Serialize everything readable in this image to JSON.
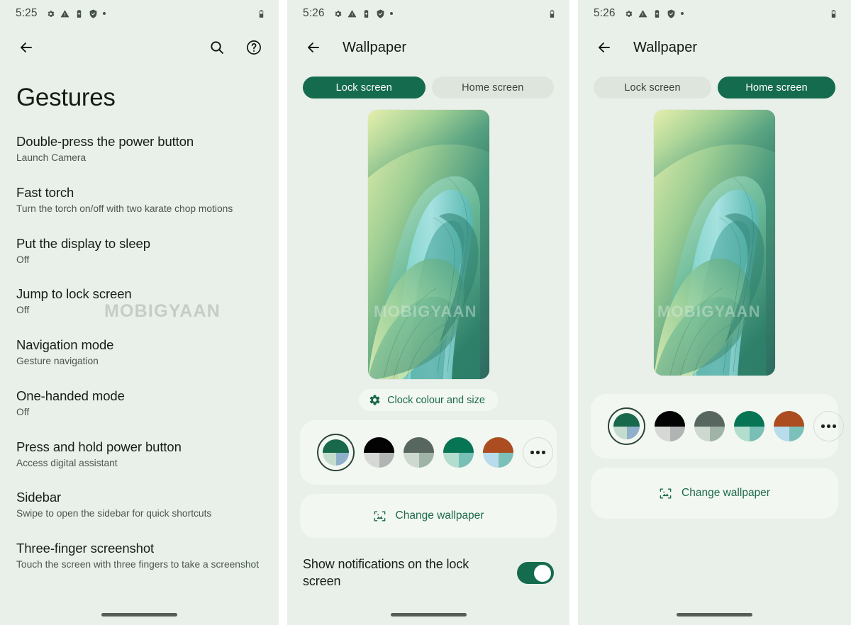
{
  "theme": {
    "page_bg": "#e9f0e9",
    "card_bg": "#f2f7f1",
    "accent_green": "#146b4d",
    "link_green": "#1d6a4b",
    "text_primary": "#181d17",
    "text_secondary": "#4b5550",
    "tab_inactive_bg": "#dde5dd"
  },
  "watermark": {
    "text": "MOBIGYAAN"
  },
  "panel1": {
    "status": {
      "time": "5:25",
      "icons": [
        "gear-icon",
        "warning-triangle-icon",
        "battery-saver-icon",
        "shield-icon",
        "dot-icon"
      ],
      "battery": "battery-icon"
    },
    "appbar": {
      "back": "back-arrow-icon",
      "search": "search-icon",
      "help": "help-circle-icon"
    },
    "page_title": "Gestures",
    "items": [
      {
        "title": "Double-press the power button",
        "subtitle": "Launch Camera"
      },
      {
        "title": "Fast torch",
        "subtitle": "Turn the torch on/off with two karate chop motions"
      },
      {
        "title": "Put the display to sleep",
        "subtitle": "Off"
      },
      {
        "title": "Jump to lock screen",
        "subtitle": "Off"
      },
      {
        "title": "Navigation mode",
        "subtitle": "Gesture navigation"
      },
      {
        "title": "One-handed mode",
        "subtitle": "Off"
      },
      {
        "title": "Press and hold power button",
        "subtitle": "Access digital assistant"
      },
      {
        "title": "Sidebar",
        "subtitle": "Swipe to open the sidebar for quick shortcuts"
      },
      {
        "title": "Three-finger screenshot",
        "subtitle": "Touch the screen with three fingers to take a screenshot"
      }
    ]
  },
  "panel2": {
    "status": {
      "time": "5:26"
    },
    "appbar": {
      "title": "Wallpaper",
      "back": "back-arrow-icon"
    },
    "tabs": [
      {
        "label": "Lock screen",
        "active": true
      },
      {
        "label": "Home screen",
        "active": false
      }
    ],
    "clock_chip": {
      "label": "Clock colour and size",
      "icon": "gear-icon"
    },
    "swatches": [
      {
        "name": "green-swatch",
        "selected": true,
        "top": "#18694c",
        "bl": "#c4dcce",
        "br": "#8fb0ca"
      },
      {
        "name": "black-swatch",
        "selected": false,
        "top": "#030303",
        "bl": "#d6d8d6",
        "br": "#b0b4b2"
      },
      {
        "name": "grey-swatch",
        "selected": false,
        "top": "#586660",
        "bl": "#cdd8cf",
        "br": "#9fb3a6"
      },
      {
        "name": "teal-swatch",
        "selected": false,
        "top": "#077553",
        "bl": "#b3ddcd",
        "br": "#78bfb6"
      },
      {
        "name": "brown-swatch",
        "selected": false,
        "top": "#ab4d20",
        "bl": "#b9dced",
        "br": "#7cc0ba"
      }
    ],
    "more_swatches": "more-colours-button",
    "change_wallpaper": {
      "label": "Change wallpaper",
      "icon": "image-icon"
    },
    "notifications_toggle": {
      "label": "Show notifications on the lock screen",
      "on": true
    }
  },
  "panel3": {
    "status": {
      "time": "5:26"
    },
    "appbar": {
      "title": "Wallpaper",
      "back": "back-arrow-icon"
    },
    "tabs": [
      {
        "label": "Lock screen",
        "active": false
      },
      {
        "label": "Home screen",
        "active": true
      }
    ],
    "swatches": [
      {
        "name": "green-swatch",
        "selected": true,
        "top": "#18694c",
        "bl": "#c4dcce",
        "br": "#8fb0ca"
      },
      {
        "name": "black-swatch",
        "selected": false,
        "top": "#030303",
        "bl": "#d6d8d6",
        "br": "#b0b4b2"
      },
      {
        "name": "grey-swatch",
        "selected": false,
        "top": "#586660",
        "bl": "#cdd8cf",
        "br": "#9fb3a6"
      },
      {
        "name": "teal-swatch",
        "selected": false,
        "top": "#077553",
        "bl": "#b3ddcd",
        "br": "#78bfb6"
      },
      {
        "name": "brown-swatch",
        "selected": false,
        "top": "#ab4d20",
        "bl": "#b9dced",
        "br": "#7cc0ba"
      }
    ],
    "more_swatches": "more-colours-button",
    "change_wallpaper": {
      "label": "Change wallpaper",
      "icon": "image-icon"
    }
  }
}
